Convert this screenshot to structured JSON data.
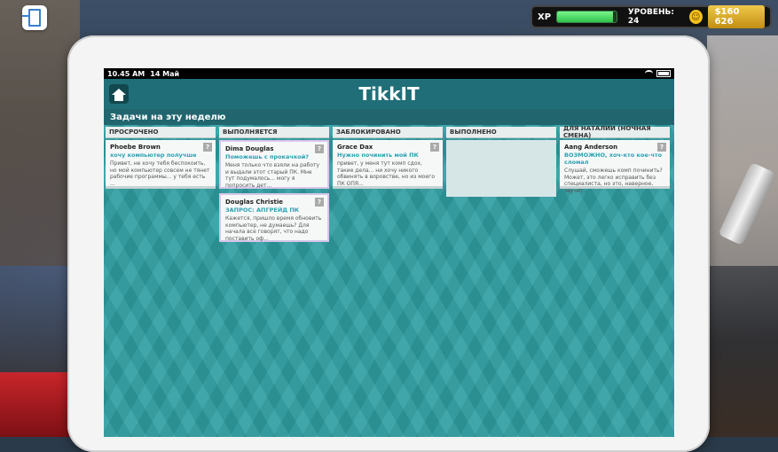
{
  "hud": {
    "xp_label": "XP",
    "xp_progress": 0.95,
    "level_label": "УРОВЕНЬ: 24",
    "money": "$160 626"
  },
  "statusbar": {
    "time": "10.45 AM",
    "date": "14 Май"
  },
  "app": {
    "title": "TikkIT",
    "week_title": "Задачи на эту неделю"
  },
  "columns": [
    {
      "header": "ПРОСРОЧЕНО",
      "cards": [
        {
          "name": "Phoebe Brown",
          "subject": "хочу компьютер получше",
          "preview": "Привет, не хочу тебя беспокоить, но мой компьютер совсем не тянет рабочие программы... у тебя есть ..."
        }
      ]
    },
    {
      "header": "ВЫПОЛНЯЕТСЯ",
      "cards": [
        {
          "name": "Dima Douglas",
          "subject": "Поможешь с прокачкой?",
          "preview": "Меня только что взяли на работу и выдали этот старый ПК. Мне тут подумалось... могу я попросить дет..."
        },
        {
          "name": "Douglas Christie",
          "subject": "ЗАПРОС: АПГРЕЙД ПК",
          "preview": "Кажется, пришло время обновить компьютер, не думаешь? Для начала все говорят, что надо поставить оф..."
        }
      ]
    },
    {
      "header": "ЗАБЛОКИРОВАНО",
      "cards": [
        {
          "name": "Grace Dax",
          "subject": "Нужно починить мой ПК",
          "preview": "привет, у меня тут комп сдох, такие дела... ни хочу никого обвинять в воровстве, но из моего ПК ОПЯ..."
        }
      ]
    },
    {
      "header": "ВЫПОЛНЕНО",
      "cards": []
    },
    {
      "header": "ДЛЯ НАТАЛИИ (НОЧНАЯ СМЕНА)",
      "cards": [
        {
          "name": "Aang Anderson",
          "subject": "ВОЗМОЖНО, хоч-кто кое-что сломал",
          "preview": "Слушай, сможешь комп починить? Может, это легко исправить без специалиста, но это, наверное, звучит..."
        }
      ]
    }
  ],
  "card_help_glyph": "?"
}
